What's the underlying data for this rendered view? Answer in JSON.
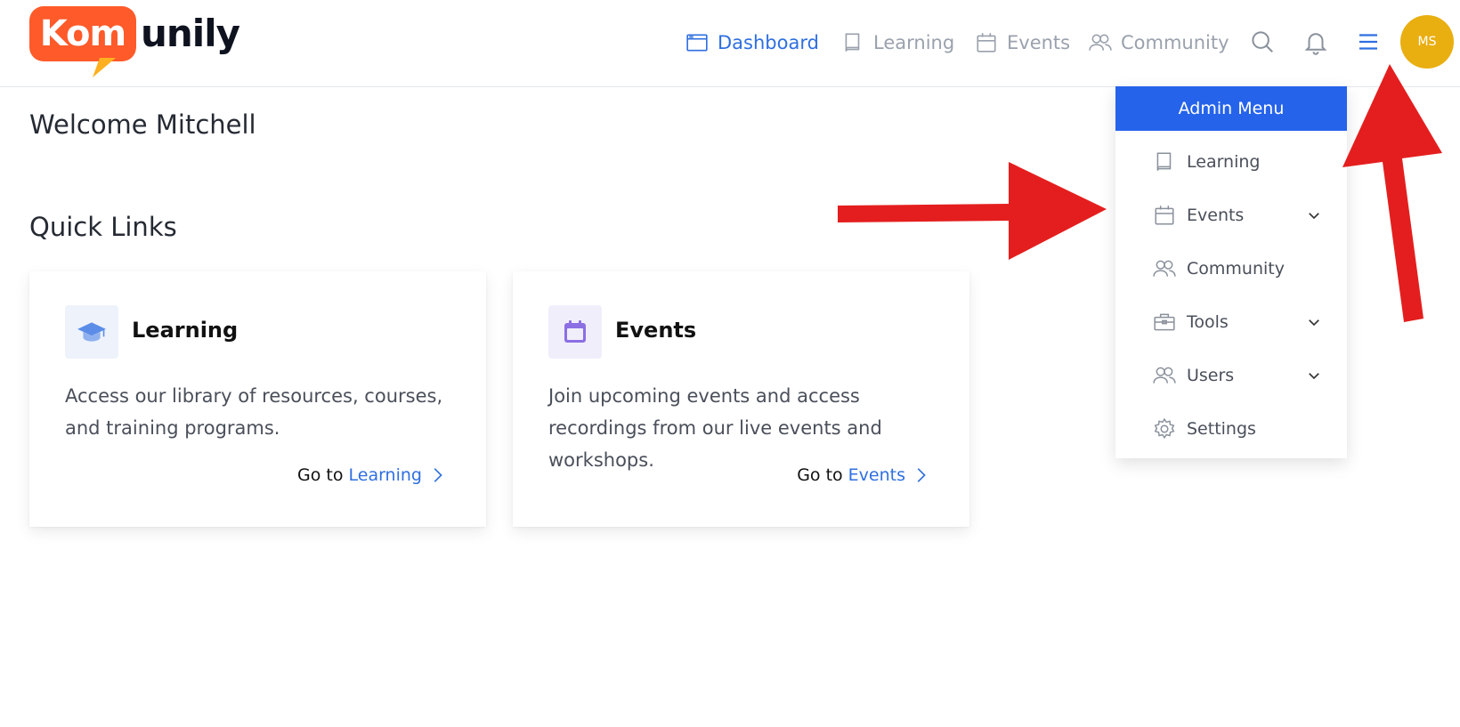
{
  "brand": {
    "badge": "Kom",
    "rest": "unily"
  },
  "nav": [
    {
      "label": "Dashboard",
      "icon": "dashboard-icon",
      "active": true
    },
    {
      "label": "Learning",
      "icon": "book-icon"
    },
    {
      "label": "Events",
      "icon": "calendar-icon"
    },
    {
      "label": "Community",
      "icon": "people-icon"
    }
  ],
  "user": {
    "initials": "MS"
  },
  "welcome": "Welcome Mitchell",
  "quick_links": {
    "title": "Quick Links",
    "cards": [
      {
        "title": "Learning",
        "icon": "graduation-cap-icon",
        "description": "Access our library of resources, courses, and training programs.",
        "link_prefix": "Go to",
        "link_text": "Learning"
      },
      {
        "title": "Events",
        "icon": "calendar-icon",
        "description": "Join upcoming events and access recordings from our live events and workshops.",
        "link_prefix": "Go to",
        "link_text": "Events"
      }
    ]
  },
  "admin_menu": {
    "title": "Admin Menu",
    "items": [
      {
        "label": "Learning",
        "icon": "book-icon",
        "expandable": false
      },
      {
        "label": "Events",
        "icon": "calendar-icon",
        "expandable": true
      },
      {
        "label": "Community",
        "icon": "people-icon",
        "expandable": false
      },
      {
        "label": "Tools",
        "icon": "toolbox-icon",
        "expandable": true
      },
      {
        "label": "Users",
        "icon": "users-icon",
        "expandable": true
      },
      {
        "label": "Settings",
        "icon": "gear-icon",
        "expandable": false
      }
    ]
  },
  "colors": {
    "accent": "#2563eb",
    "link": "#2f6fe0",
    "brand": "#ff5a2a",
    "avatar": "#e9ae10",
    "annotation": "#e41e1e"
  }
}
